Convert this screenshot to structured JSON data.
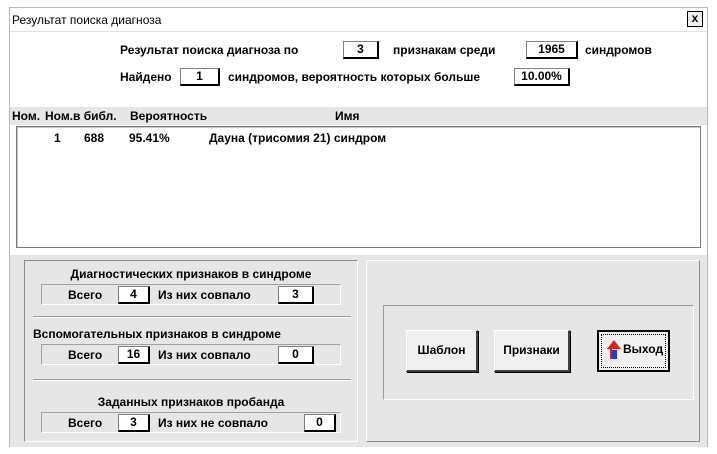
{
  "window": {
    "title": "Результат поиска диагноза",
    "close_label": "x"
  },
  "summary": {
    "line1_prefix": "Результат поиска диагноза по",
    "features_count": "3",
    "line1_mid": "признакам  среди",
    "syndromes_total": "1965",
    "line1_suffix": "синдромов",
    "line2_prefix": "Найдено",
    "found_count": "1",
    "line2_mid": "синдромов, вероятность которых больше",
    "threshold": "10.00%"
  },
  "table": {
    "columns": [
      "Ном.",
      "Ном.в библ.",
      "Вероятность",
      "Имя"
    ],
    "rows": [
      {
        "num": "1",
        "lib_num": "688",
        "probability": "95.41%",
        "name": "Дауна (трисомия 21) синдром"
      }
    ]
  },
  "diag_group": {
    "title": "Диагностических признаков в синдроме",
    "total_label": "Всего",
    "total": "4",
    "match_label": "Из них совпало",
    "match": "3"
  },
  "aux_group": {
    "title": "Вспомогательных признаков в синдроме",
    "total_label": "Всего",
    "total": "16",
    "match_label": "Из них совпало",
    "match": "0"
  },
  "proband_group": {
    "title": "Заданных признаков пробанда",
    "total_label": "Всего",
    "total": "3",
    "mismatch_label": "Из них не совпало",
    "mismatch": "0"
  },
  "buttons": {
    "template": "Шаблон",
    "features": "Признаки",
    "exit": "Выход"
  },
  "icons": {
    "exit": "exit-arrow-icon",
    "close": "close-icon"
  },
  "colors": {
    "panel": "#e6e6e6",
    "exit_arrow_red": "#e02020",
    "exit_arrow_blue": "#1e3cc8"
  }
}
